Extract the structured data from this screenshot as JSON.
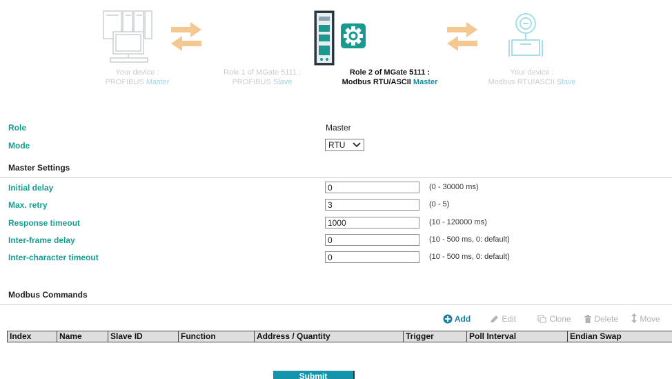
{
  "wizard": {
    "step1": {
      "line1": "Your device :",
      "line2a": "PROFIBUS ",
      "line2b": "Master"
    },
    "step2": {
      "line1": "Role 1 of MGate 5111 :",
      "line2a": "PROFIBUS ",
      "line2b": "Slave"
    },
    "step3": {
      "line1": "Role 2 of MGate 5111 :",
      "line2a": "Modbus RTU/ASCII ",
      "line2b": "Master"
    },
    "step4": {
      "line1": "Your device :",
      "line2a": "Modbus RTU/ASCII ",
      "line2b": "Slave"
    }
  },
  "role": {
    "label": "Role",
    "value": "Master"
  },
  "mode": {
    "label": "Mode",
    "value": "RTU"
  },
  "master_settings": {
    "title": "Master Settings",
    "initial_delay": {
      "label": "Initial delay",
      "value": "0",
      "range": "(0 - 30000 ms)"
    },
    "max_retry": {
      "label": "Max. retry",
      "value": "3",
      "range": "(0 - 5)"
    },
    "response_timeout": {
      "label": "Response timeout",
      "value": "1000",
      "range": "(10 - 120000 ms)"
    },
    "inter_frame_delay": {
      "label": "Inter-frame delay",
      "value": "0",
      "range": "(10 - 500 ms, 0: default)"
    },
    "inter_char_timeout": {
      "label": "Inter-character timeout",
      "value": "0",
      "range": "(10 - 500 ms, 0: default)"
    }
  },
  "modbus_commands": {
    "title": "Modbus Commands",
    "toolbar": {
      "add": "Add",
      "edit": "Edit",
      "clone": "Clone",
      "delete": "Delete",
      "move": "Move"
    },
    "columns": [
      "Index",
      "Name",
      "Slave ID",
      "Function",
      "Address / Quantity",
      "Trigger",
      "Poll Interval",
      "Endian Swap"
    ]
  },
  "submit_label": "Submit",
  "colors": {
    "accent": "#199a8f",
    "link": "#1a8aa0",
    "header_bg": "#dedede",
    "submit_bg": "#1593ab",
    "arrow": "#f4c890"
  },
  "icons": [
    "plc-rack-icon",
    "gear-icon",
    "flow-meter-icon",
    "plus-circle-icon",
    "pencil-icon",
    "clone-icon",
    "trash-icon",
    "move-icon"
  ]
}
